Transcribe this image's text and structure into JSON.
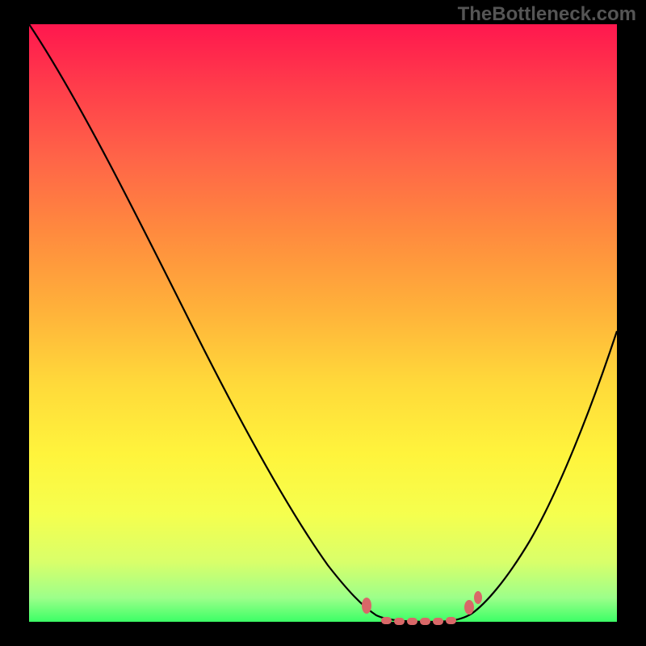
{
  "watermark": "TheBottleneck.com",
  "chart_data": {
    "type": "line",
    "title": "",
    "xlabel": "",
    "ylabel": "",
    "xlim": [
      0,
      728
    ],
    "ylim": [
      0,
      740
    ],
    "series": [
      {
        "name": "curve",
        "x": [
          0,
          80,
          160,
          240,
          320,
          370,
          400,
          420,
          445,
          465,
          490,
          520,
          545,
          570,
          600,
          640,
          680,
          728
        ],
        "values": [
          0,
          120,
          260,
          420,
          580,
          670,
          710,
          725,
          735,
          738,
          738,
          736,
          730,
          715,
          680,
          600,
          500,
          380
        ]
      }
    ],
    "markers": {
      "left_tick": {
        "x": 418,
        "y": 720
      },
      "right_tick": {
        "x": 545,
        "y": 720
      },
      "right_tick2": {
        "x": 555,
        "y": 712
      },
      "flat_band": {
        "x0": 438,
        "x1": 535,
        "y": 738
      }
    },
    "gradient_background": true
  }
}
